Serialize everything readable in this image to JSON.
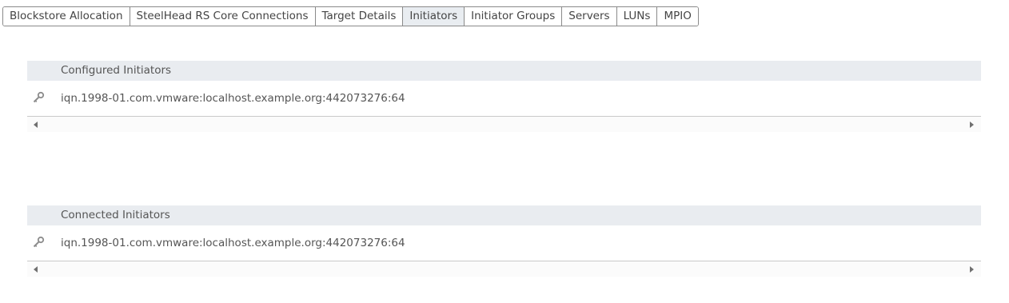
{
  "tabs": [
    {
      "label": "Blockstore Allocation"
    },
    {
      "label": "SteelHead RS Core Connections"
    },
    {
      "label": "Target Details"
    },
    {
      "label": "Initiators"
    },
    {
      "label": "Initiator Groups"
    },
    {
      "label": "Servers"
    },
    {
      "label": "LUNs"
    },
    {
      "label": "MPIO"
    }
  ],
  "active_tab": "Initiators",
  "configured": {
    "header": "Configured Initiators",
    "icon": "key-icon",
    "items": [
      {
        "name": "iqn.1998-01.com.vmware:localhost.example.org:442073276:64"
      }
    ]
  },
  "connected": {
    "header": "Connected Initiators",
    "icon": "key-icon",
    "items": [
      {
        "name": "iqn.1998-01.com.vmware:localhost.example.org:442073276:64"
      }
    ]
  }
}
